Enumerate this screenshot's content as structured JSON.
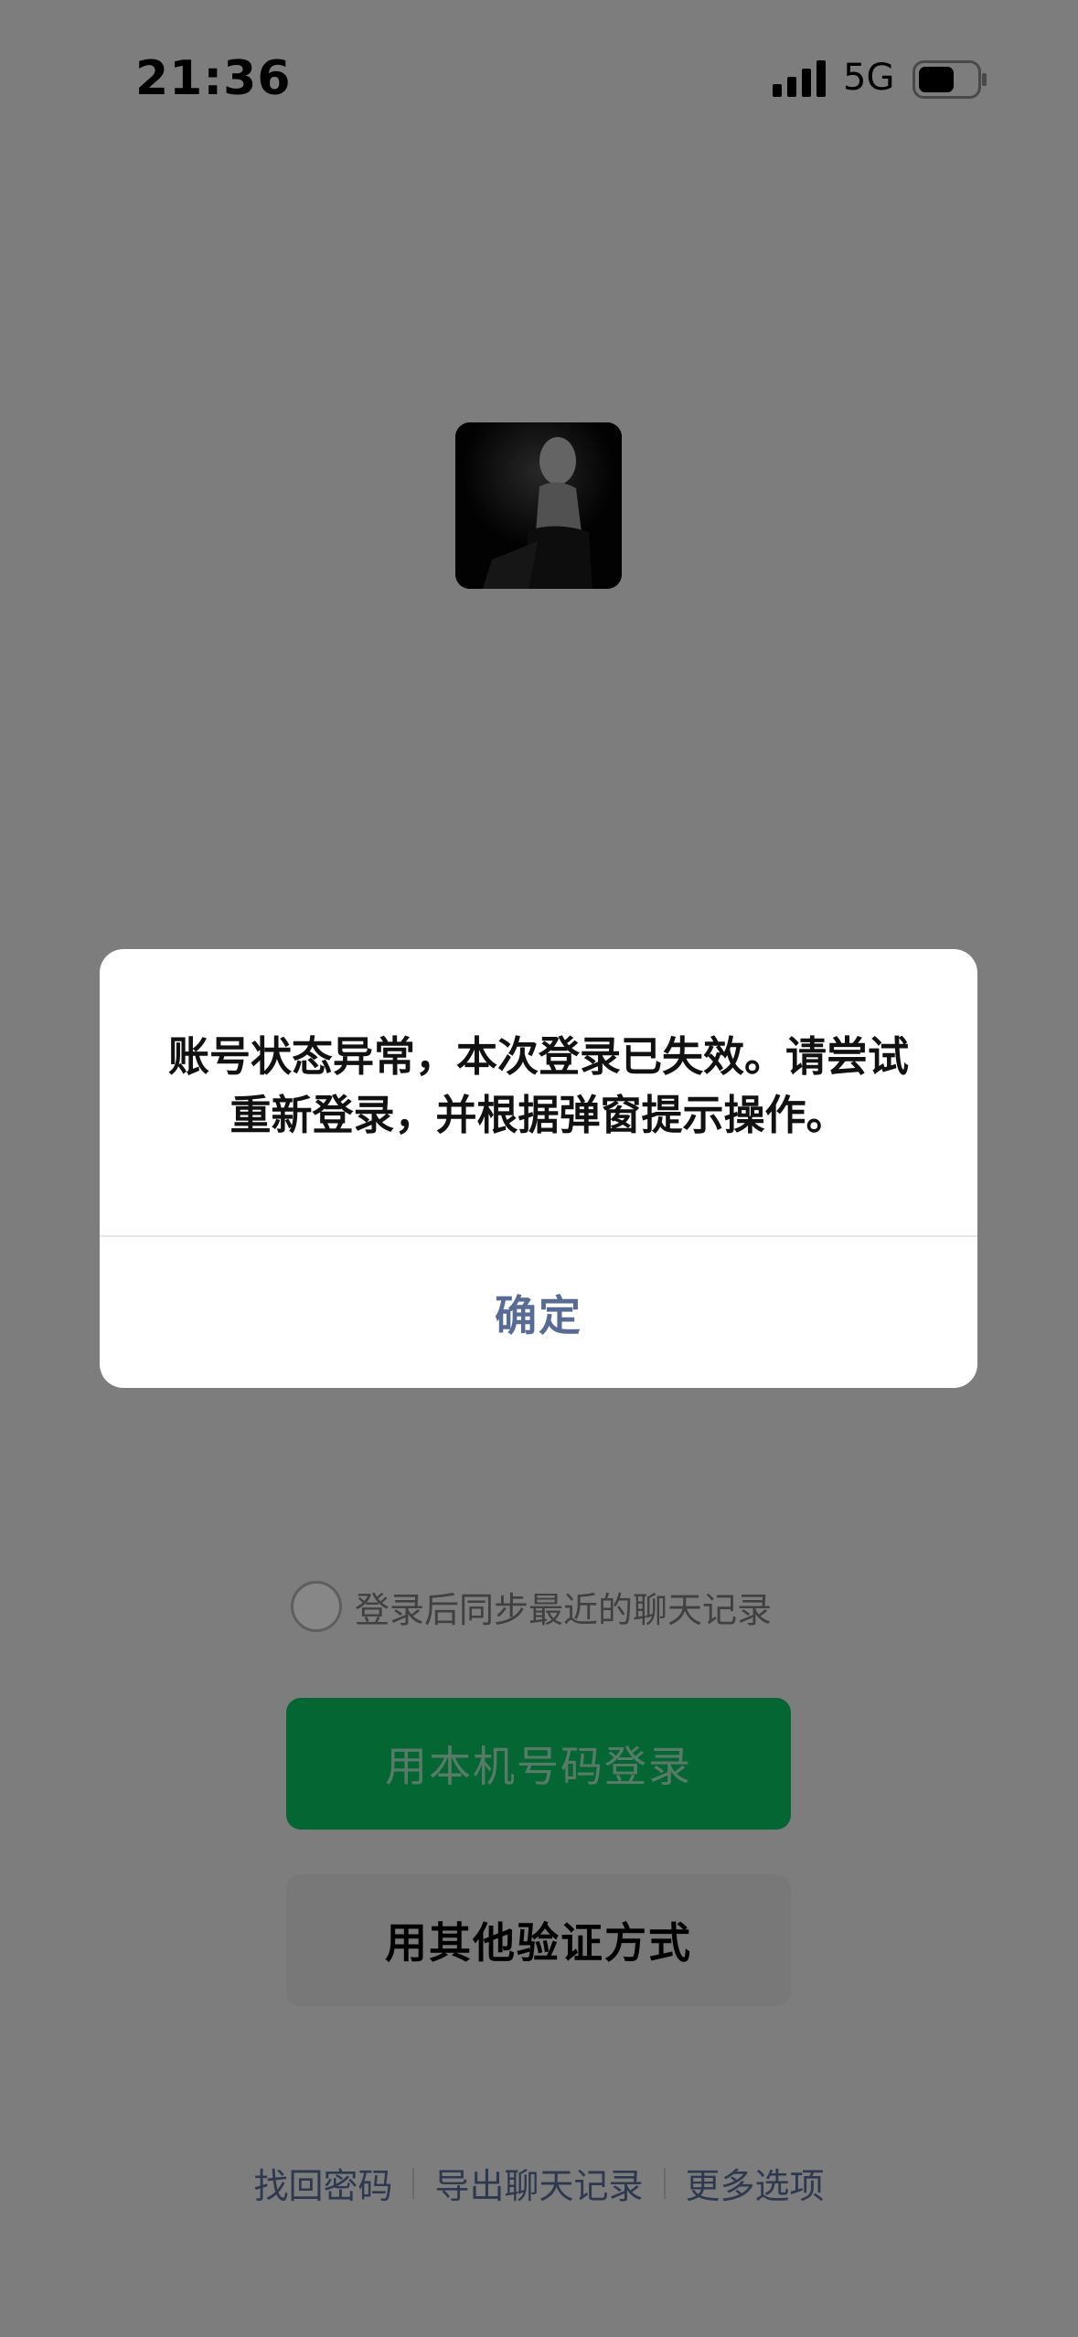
{
  "status_bar": {
    "time": "21:36",
    "network": "5G",
    "signal_icon": "signal-bars-icon",
    "battery_icon": "battery-icon"
  },
  "login": {
    "avatar_icon": "avatar",
    "sync_label": "登录后同步最近的聊天记录",
    "primary_button": "用本机号码登录",
    "secondary_button": "用其他验证方式"
  },
  "footer": {
    "links": [
      "找回密码",
      "导出聊天记录",
      "更多选项"
    ]
  },
  "dialog": {
    "message": "账号状态异常，本次登录已失效。请尝试重新登录，并根据弹窗提示操作。",
    "confirm_label": "确定"
  },
  "colors": {
    "accent_green": "#07c160",
    "link_blue": "#576b95"
  }
}
